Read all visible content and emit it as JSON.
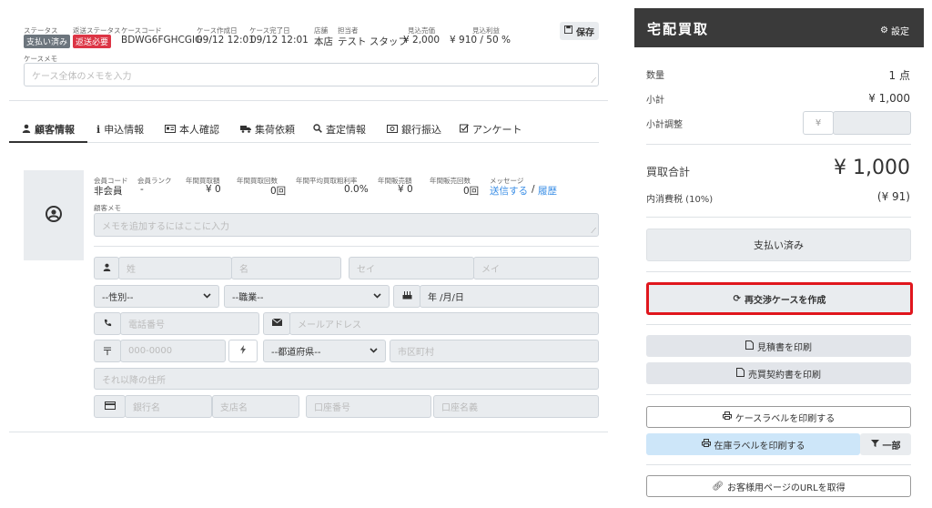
{
  "header": {
    "status_label": "ステータス",
    "status_value": "支払い済み",
    "return_status_label": "返送ステータス",
    "return_status_value": "返送必要",
    "case_code_label": "ケースコード",
    "case_code": "BDWG6FGHCGIG",
    "created_label": "ケース作成日",
    "created_value": "09/12 12:01",
    "completed_label": "ケース完了日",
    "completed_value": "09/12 12:01",
    "store_label": "店舗",
    "store_value": "本店",
    "staff_label": "担当者",
    "staff_value": "テスト スタッフ",
    "est_sales_label": "見込売価",
    "est_sales_value": "¥ 2,000",
    "est_profit_label": "見込利益",
    "est_profit_value": "¥ 910 / 50 %",
    "save_label": "保存",
    "memo_label": "ケースメモ",
    "memo_placeholder": "ケース全体のメモを入力"
  },
  "tabs": [
    "顧客情報",
    "申込情報",
    "本人確認",
    "集荷依頼",
    "査定情報",
    "銀行振込",
    "アンケート"
  ],
  "customer": {
    "member_code_label": "会員コード",
    "member_code_value": "非会員",
    "member_rank_label": "会員ランク",
    "member_rank_value": "-",
    "annual_purchase_amount_label": "年間買取額",
    "annual_purchase_amount_value": "¥ 0",
    "annual_purchase_count_label": "年間買取回数",
    "annual_purchase_count_value": "0回",
    "annual_margin_label": "年間平均買取粗利率",
    "annual_margin_value": "0.0%",
    "annual_sales_amount_label": "年間販売額",
    "annual_sales_amount_value": "¥ 0",
    "annual_sales_count_label": "年間販売回数",
    "annual_sales_count_value": "0回",
    "message_label": "メッセージ",
    "send_link": "送信する",
    "link_sep": "/",
    "history_link": "履歴",
    "memo_label": "顧客メモ",
    "memo_placeholder": "メモを追加するにはここに入力"
  },
  "form": {
    "last_name_ph": "姓",
    "first_name_ph": "名",
    "last_kana_ph": "セイ",
    "first_kana_ph": "メイ",
    "gender_ph": "--性別--",
    "occupation_ph": "--職業--",
    "birthday_ph": "年 /月/日",
    "phone_ph": "電話番号",
    "email_ph": "メールアドレス",
    "postal_ph": "000-0000",
    "prefecture_ph": "--都道府県--",
    "city_ph": "市区町村",
    "address_ph": "それ以降の住所",
    "bank_name_ph": "銀行名",
    "branch_ph": "支店名",
    "account_no_ph": "口座番号",
    "account_holder_ph": "口座名義"
  },
  "panel": {
    "title": "宅配買取",
    "settings": "設定",
    "quantity_label": "数量",
    "quantity_value": "1 点",
    "subtotal_label": "小計",
    "subtotal_value": "¥ 1,000",
    "adjust_label": "小計調整",
    "yen": "¥",
    "total_label": "買取合計",
    "total_value": "¥ 1,000",
    "tax_label": "内消費税 (10%)",
    "tax_value": "(¥ 91)",
    "paid_button": "支払い済み",
    "renegotiate_button": "再交渉ケースを作成",
    "print_estimate": "見積書を印刷",
    "print_contract": "売買契約書を印刷",
    "print_case_label": "ケースラベルを印刷する",
    "print_stock_label": "在庫ラベルを印刷する",
    "partial": "一部",
    "get_url": "お客様用ページのURLを取得"
  }
}
